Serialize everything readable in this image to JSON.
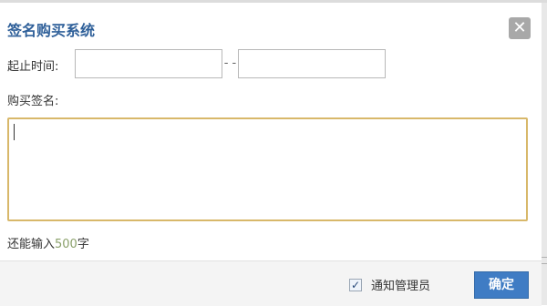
{
  "dialog": {
    "title": "签名购买系统",
    "close_glyph": "✕",
    "time_label": "起止时间:",
    "date_separator": "- -",
    "start_date_value": "",
    "end_date_value": "",
    "signature_label": "购买签名:",
    "signature_value": "",
    "remaining_prefix": "还能输入",
    "remaining_count": "500",
    "remaining_suffix": "字",
    "notify_admin_label": "通知管理员",
    "notify_admin_checked": true,
    "checkbox_glyph": "✓",
    "confirm_label": "确定"
  },
  "icons": {
    "close": "close-icon",
    "check": "checkmark-icon"
  },
  "colors": {
    "title": "#2e5f99",
    "textarea_border": "#d8b86a",
    "count_highlight": "#8aa06a",
    "confirm_button": "#3f7cc4",
    "close_button": "#a8a8a8"
  }
}
